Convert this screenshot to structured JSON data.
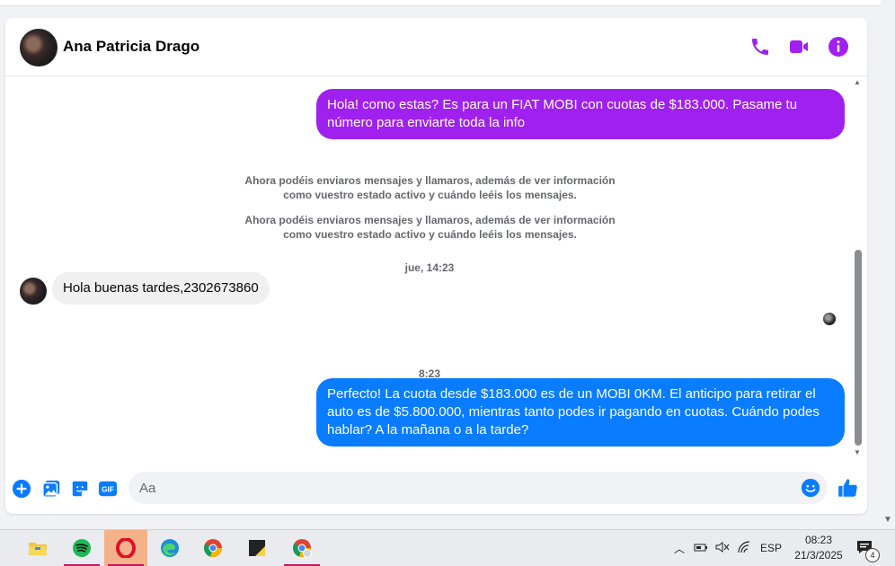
{
  "header": {
    "contact_name": "Ana Patricia Drago",
    "icons": [
      "phone-icon",
      "video-call-icon",
      "info-icon"
    ]
  },
  "messages": {
    "outgoing_1": "Hola! como estas? Es para un FIAT MOBI con cuotas de $183.000. Pasame tu número para enviarte toda la info",
    "system_note_1": "Ahora podéis enviaros mensajes y llamaros, además de ver información como vuestro estado activo y cuándo leéis los mensajes.",
    "system_note_2": "Ahora podéis enviaros mensajes y llamaros, además de ver información como vuestro estado activo y cuándo leéis los mensajes.",
    "timestamp_1": "jue, 14:23",
    "incoming_1": "Hola buenas tardes,2302673860",
    "timestamp_2": "8:23",
    "outgoing_2": "Perfecto! La cuota desde $183.000 es de un MOBI 0KM. El anticipo para retirar el auto es de $5.800.000, mientras tanto podes ir pagando en cuotas. Cuándo podes hablar? A la mañana o a la tarde?"
  },
  "composer": {
    "placeholder": "Aa",
    "icons": [
      "add-icon",
      "photo-icon",
      "sticker-icon",
      "gif-icon",
      "emoji-icon",
      "like-icon"
    ],
    "gif_label": "GIF"
  },
  "taskbar": {
    "apps": [
      "file-explorer-icon",
      "spotify-icon",
      "opera-icon",
      "edge-icon",
      "chrome-icon",
      "sticky-notes-icon",
      "chrome-profile-icon"
    ],
    "language": "ESP",
    "time": "08:23",
    "date": "21/3/2025",
    "notification_count": "4"
  },
  "colors": {
    "accent": "#a020f0",
    "outgoing_purple": "#a020f0",
    "outgoing_blue": "#0a7cff",
    "composer_blue": "#0a7cff"
  }
}
